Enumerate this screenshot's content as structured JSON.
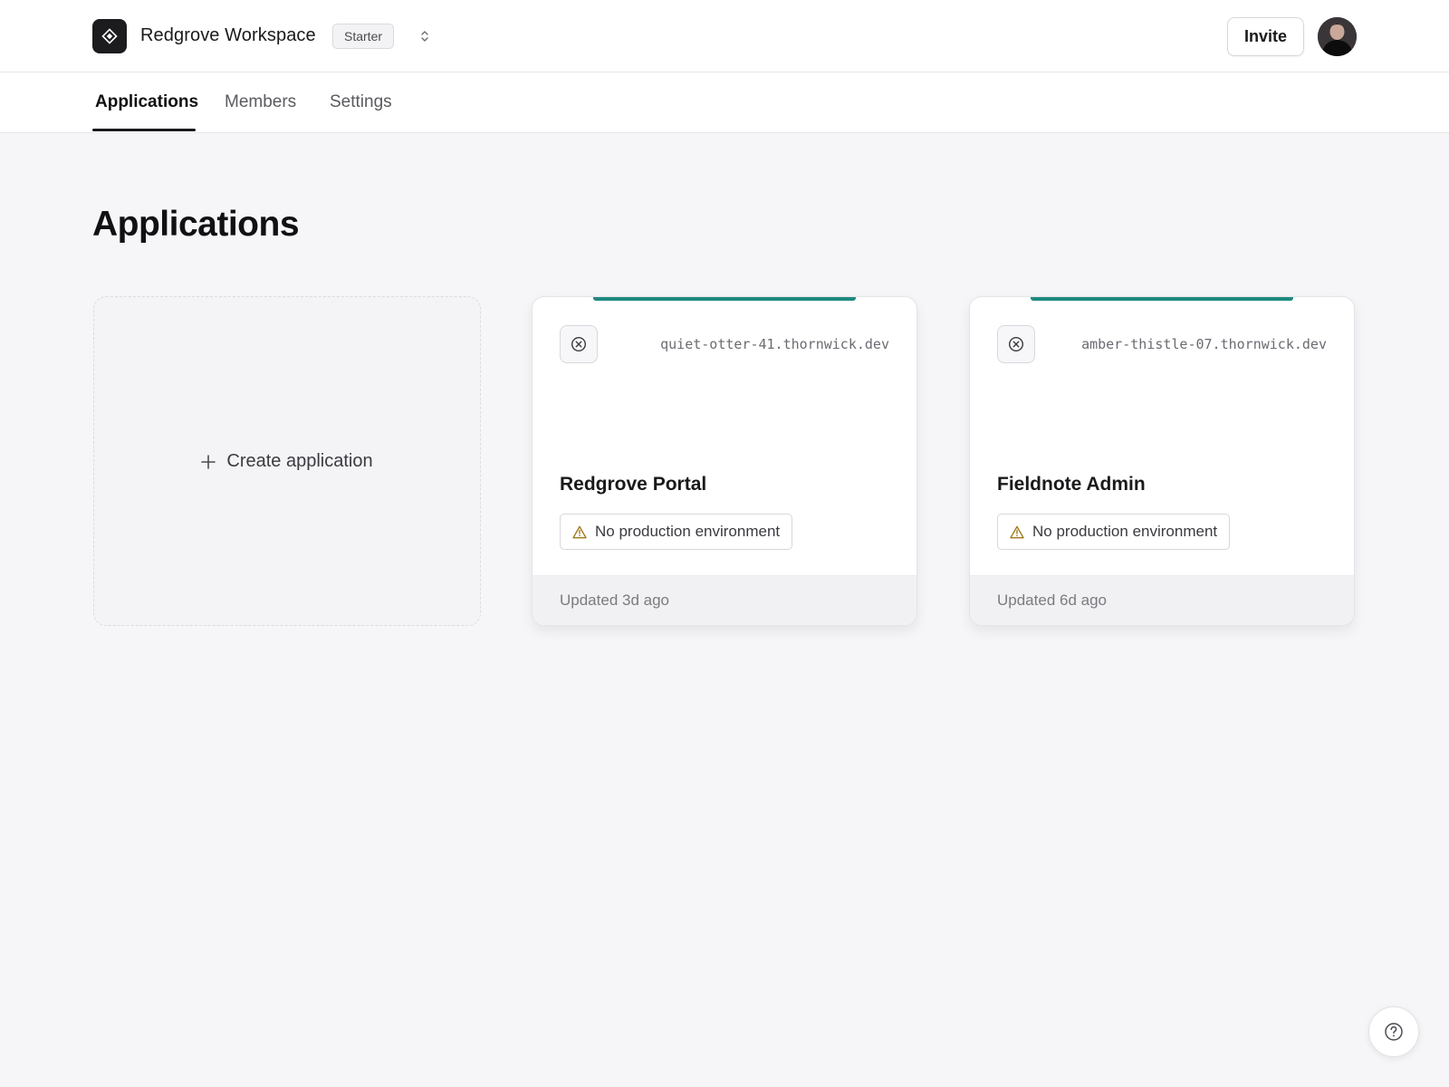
{
  "header": {
    "workspace_name": "Redgrove Workspace",
    "plan_badge": "Starter",
    "invite_label": "Invite",
    "logo_icon": "diamond-logo-icon",
    "switcher_icon": "chevron-up-down-icon"
  },
  "tabs": [
    {
      "label": "Applications",
      "active": true
    },
    {
      "label": "Members",
      "active": false
    },
    {
      "label": "Settings",
      "active": false
    }
  ],
  "main": {
    "title": "Applications",
    "create_label": "Create application",
    "create_icon": "plus-icon"
  },
  "applications": [
    {
      "domain": "quiet-otter-41.thornwick.dev",
      "name": "Redgrove Portal",
      "warning": "No production environment",
      "updated": "Updated 3d ago",
      "status_icon": "circle-x-icon"
    },
    {
      "domain": "amber-thistle-07.thornwick.dev",
      "name": "Fieldnote Admin",
      "warning": "No production environment",
      "updated": "Updated 6d ago",
      "status_icon": "circle-x-icon"
    }
  ],
  "colors": {
    "accent": "#1f8a80",
    "warning": "#a07a1c",
    "text_primary": "#1a1a1c",
    "background": "#f6f6f8"
  },
  "help": {
    "icon": "help-circle-icon"
  }
}
